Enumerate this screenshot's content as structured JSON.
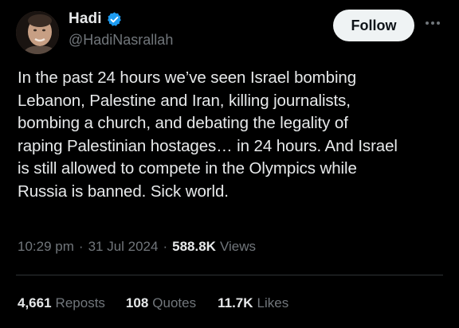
{
  "author": {
    "display_name": "Hadi",
    "handle": "@HadiNasrallah",
    "verified": true,
    "verified_icon": "verified-badge-icon",
    "verified_color": "#1d9bf0"
  },
  "actions": {
    "follow_label": "Follow",
    "more_icon": "more-horizontal-icon"
  },
  "post": {
    "text": "In the past 24 hours we’ve seen Israel bombing\nLebanon, Palestine and Iran, killing journalists,\nbombing a church, and debating the legality of\nraping Palestinian hostages… in 24 hours. And Israel\nis still allowed to compete in the Olympics while\nRussia is banned. Sick world."
  },
  "meta": {
    "time": "10:29 pm",
    "separator": "·",
    "date": "31 Jul 2024",
    "views_count": "588.8K",
    "views_label": "Views"
  },
  "stats": {
    "reposts_count": "4,661",
    "reposts_label": "Reposts",
    "quotes_count": "108",
    "quotes_label": "Quotes",
    "likes_count": "11.7K",
    "likes_label": "Likes"
  },
  "colors": {
    "background": "#000000",
    "primary_text": "#e7e9ea",
    "secondary_text": "#71767b",
    "divider": "#2f3336",
    "follow_button_bg": "#eff3f4"
  }
}
